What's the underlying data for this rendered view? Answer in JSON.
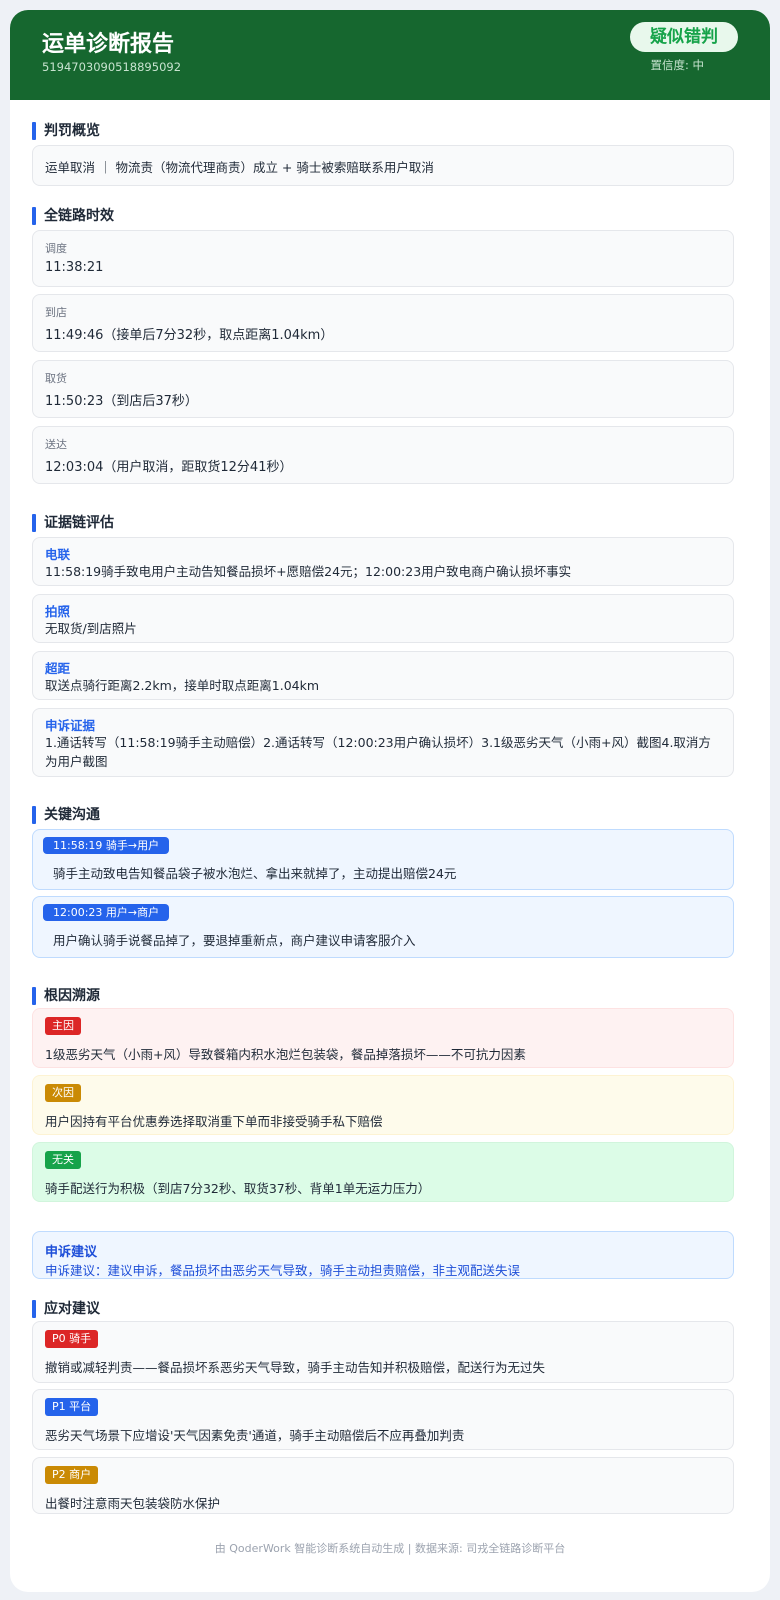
{
  "header": {
    "title": "运单诊断报告",
    "order_id": "5194703090518895092",
    "verdict": "疑似错判",
    "confidence": "置信度: 中",
    "colors": {
      "header_bg": "#16672f",
      "verdict_text": "#16a34a"
    }
  },
  "summary": {
    "title": "判罚概览",
    "text": "运单取消 ｜ 物流责（物流代理商责）成立 + 骑士被索赔联系用户取消"
  },
  "timeline": {
    "title": "全链路时效",
    "items": [
      {
        "label": "调度",
        "value": "11:38:21"
      },
      {
        "label": "到店",
        "value": "11:49:46（接单后7分32秒，取点距离1.04km）"
      },
      {
        "label": "取货",
        "value": "11:50:23（到店后37秒）"
      },
      {
        "label": "送达",
        "value": "12:03:04（用户取消，距取货12分41秒）"
      }
    ]
  },
  "evidence": {
    "title": "证据链评估",
    "items": [
      {
        "title": "电联",
        "body": "11:58:19骑手致电用户主动告知餐品损坏+愿赔偿24元；12:00:23用户致电商户确认损坏事实"
      },
      {
        "title": "拍照",
        "body": "无取货/到店照片"
      },
      {
        "title": "超距",
        "body": "取送点骑行距离2.2km，接单时取点距离1.04km"
      },
      {
        "title": "申诉证据",
        "body": "1.通话转写（11:58:19骑手主动赔偿）2.通话转写（12:00:23用户确认损坏）3.1级恶劣天气（小雨+风）截图4.取消方为用户截图"
      }
    ]
  },
  "communication": {
    "title": "关键沟通",
    "items": [
      {
        "tag": "11:58:19  骑手→用户",
        "body": "骑手主动致电告知餐品袋子被水泡烂、拿出来就掉了，主动提出赔偿24元"
      },
      {
        "tag": "12:00:23  用户→商户",
        "body": "用户确认骑手说餐品掉了，要退掉重新点，商户建议申请客服介入"
      }
    ]
  },
  "root_cause": {
    "title": "根因溯源",
    "items": [
      {
        "tag": "主因",
        "body": "1级恶劣天气（小雨+风）导致餐箱内积水泡烂包装袋，餐品掉落损坏——不可抗力因素",
        "color": "#dc2626",
        "bg": "#fef2f2"
      },
      {
        "tag": "次因",
        "body": "用户因持有平台优惠券选择取消重下单而非接受骑手私下赔偿",
        "color": "#ca8a04",
        "bg": "#fefbeb"
      },
      {
        "tag": "无关",
        "body": "骑手配送行为积极（到店7分32秒、取货37秒、背单1单无运力压力）",
        "color": "#16a34a",
        "bg": "#dcfce7"
      }
    ]
  },
  "appeal": {
    "title": "申诉建议",
    "body": "申诉建议：建议申诉，餐品损坏由恶劣天气导致，骑手主动担责赔偿，非主观配送失误"
  },
  "actions": {
    "title": "应对建议",
    "items": [
      {
        "tag": "P0 骑手",
        "body": "撤销或减轻判责——餐品损坏系恶劣天气导致，骑手主动告知并积极赔偿，配送行为无过失",
        "color": "#dc2626"
      },
      {
        "tag": "P1 平台",
        "body": "恶劣天气场景下应增设'天气因素免责'通道，骑手主动赔偿后不应再叠加判责",
        "color": "#2563eb"
      },
      {
        "tag": "P2 商户",
        "body": "出餐时注意雨天包装袋防水保护",
        "color": "#ca8a04"
      }
    ]
  },
  "footer": {
    "text": "由 QoderWork 智能诊断系统自动生成 | 数据来源: 司戎全链路诊断平台"
  }
}
